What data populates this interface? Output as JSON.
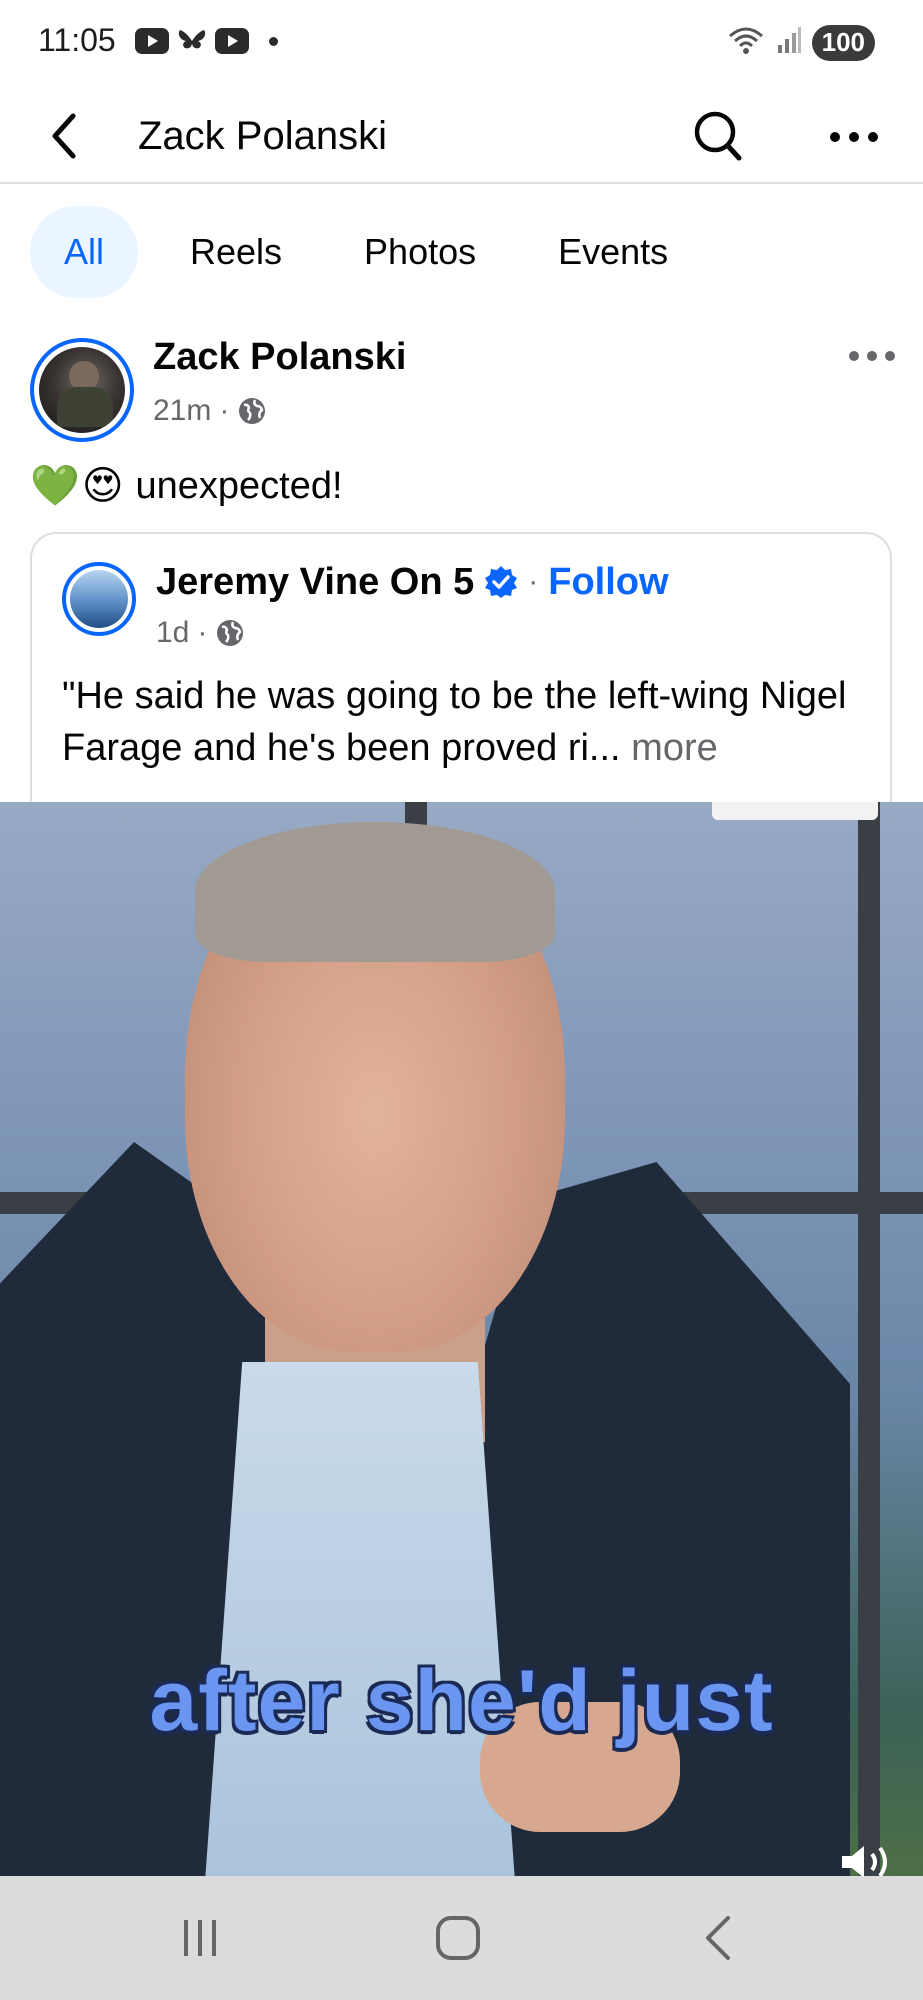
{
  "status_bar": {
    "time": "11:05",
    "battery": "100"
  },
  "header": {
    "title": "Zack Polanski"
  },
  "tabs": [
    {
      "label": "All",
      "active": true
    },
    {
      "label": "Reels",
      "active": false
    },
    {
      "label": "Photos",
      "active": false
    },
    {
      "label": "Events",
      "active": false
    }
  ],
  "post": {
    "author": "Zack Polanski",
    "time": "21m",
    "separator": "·",
    "text": "unexpected!",
    "emojis": [
      "💚",
      "😍"
    ]
  },
  "shared_post": {
    "author": "Jeremy Vine On 5",
    "follow_label": "Follow",
    "time": "1d",
    "separator": "·",
    "text": "\"He said he was going to be the left-wing Nigel Farage and he's been proved ri...",
    "more_label": "more"
  },
  "video": {
    "caption": "after she'd just"
  },
  "colors": {
    "accent": "#0866ff",
    "secondary_text": "#65676b",
    "active_tab_bg": "#ebf5ff"
  }
}
